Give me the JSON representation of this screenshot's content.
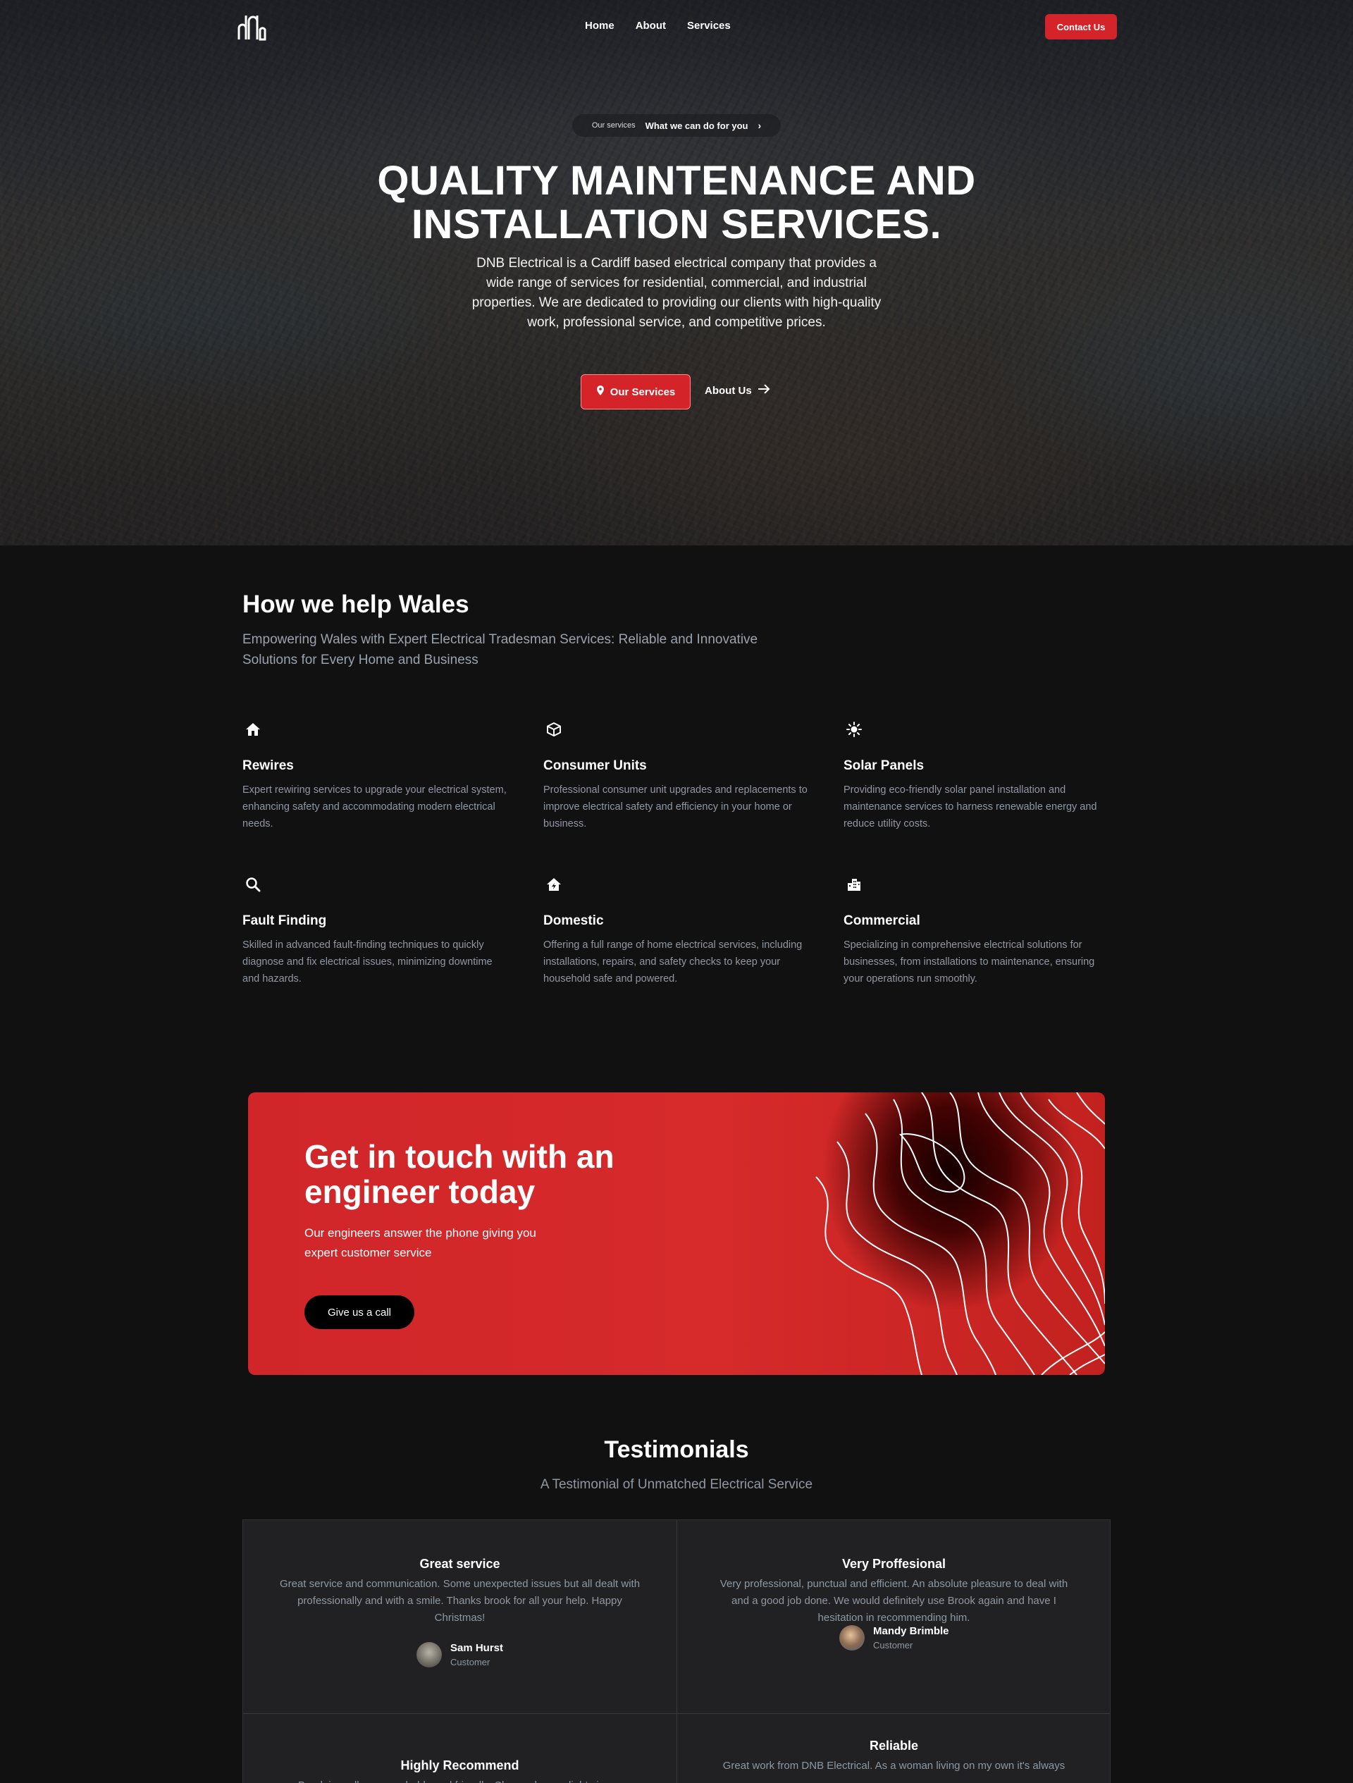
{
  "nav": {
    "links": [
      "Home",
      "About",
      "Services"
    ],
    "contact_label": "Contact Us",
    "logo_icon": "dnb-logo-icon"
  },
  "hero": {
    "pill_small": "Our services",
    "pill_link": "What we can do for you",
    "title_line1": "QUALITY MAINTENANCE AND",
    "title_line2": "INSTALLATION SERVICES.",
    "subtitle": "DNB Electrical is a Cardiff based electrical company that provides a wide range of services for residential, commercial, and industrial properties. We are dedicated to providing our clients with high-quality work, professional service, and competitive prices.",
    "primary_button": "Our Services",
    "secondary_button": "About Us"
  },
  "help": {
    "title": "How we help Wales",
    "subtitle": "Empowering Wales with Expert Electrical Tradesman Services: Reliable and Innovative Solutions for Every Home and Business",
    "services": [
      {
        "icon": "house-icon",
        "title": "Rewires",
        "text": "Expert rewiring services to upgrade your electrical system, enhancing safety and accommodating modern electrical needs."
      },
      {
        "icon": "cube-icon",
        "title": "Consumer Units",
        "text": "Professional consumer unit upgrades and replacements to improve electrical safety and efficiency in your home or business."
      },
      {
        "icon": "sun-icon",
        "title": "Solar Panels",
        "text": "Providing eco-friendly solar panel installation and maintenance services to harness renewable energy and reduce utility costs."
      },
      {
        "icon": "magnifier-icon",
        "title": "Fault Finding",
        "text": "Skilled in advanced fault-finding techniques to quickly diagnose and fix electrical issues, minimizing downtime and hazards."
      },
      {
        "icon": "home-bolt-icon",
        "title": "Domestic",
        "text": "Offering a full range of home electrical services, including installations, repairs, and safety checks to keep your household safe and powered."
      },
      {
        "icon": "buildings-icon",
        "title": "Commercial",
        "text": "Specializing in comprehensive electrical solutions for businesses, from installations to maintenance, ensuring your operations run smoothly."
      }
    ]
  },
  "cta": {
    "title": "Get in touch with an engineer today",
    "text": "Our engineers answer the phone giving you expert customer service",
    "button": "Give us a call"
  },
  "testimonials": {
    "title": "Testimonials",
    "subtitle": "A Testimonial of Unmatched Electrical Service",
    "items": [
      {
        "title": "Great service",
        "text": "Great service and communication. Some unexpected issues but all dealt with professionally and with a smile. Thanks brook for all your help. Happy Christmas!",
        "name": "Sam Hurst",
        "role": "Customer"
      },
      {
        "title": "Very Proffesional",
        "text": "Very professional, punctual and efficient. An absolute pleasure to deal with and a good job done. We would definitely use Brook again and have I hesitation in recommending him.",
        "name": "Mandy Brimble",
        "role": "Customer"
      },
      {
        "title": "Highly Recommend",
        "text": "Brook is really approachable and friendly. Changed some lights in my",
        "name": "",
        "role": ""
      },
      {
        "title": "Reliable",
        "text": "Great work from DNB Electrical. As a woman living on my own it's always",
        "name": "",
        "role": ""
      }
    ]
  },
  "colors": {
    "accent": "#d4242a",
    "background": "#111112",
    "card": "#212124",
    "muted_text": "#8f98a2"
  }
}
